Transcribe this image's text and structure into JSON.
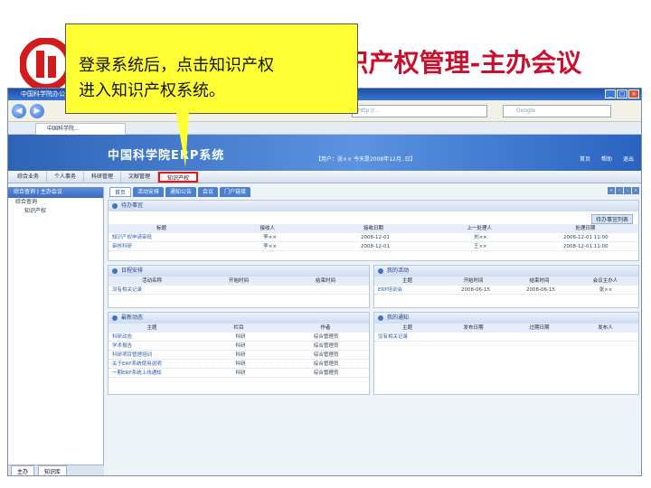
{
  "slide": {
    "title": "四-知识产权管理-主办会议",
    "callout_text": "登录系统后，点击知识产权\n进入知识产权系统。"
  },
  "browser": {
    "window_title": "中国科学院办公自",
    "address": "http://...",
    "search_placeholder": "Google",
    "tab_label": "中国科学院..."
  },
  "app": {
    "title": "中国科学院ERP系统",
    "user_info": "【用户：张××  今天是2008年12月..日】",
    "links": [
      "首页",
      "帮助",
      "退出"
    ],
    "modules": [
      "综合业务",
      "个人事务",
      "科研管理",
      "文献管理",
      "知识产权"
    ],
    "active_module": "知识产权"
  },
  "left_panel": {
    "header": "综合查询 | 主办会议",
    "tree": [
      "综合查询",
      "知识产权"
    ],
    "footer": [
      "主办",
      "知识库"
    ]
  },
  "main": {
    "subtabs": [
      "首页",
      "活动安排",
      "通知公告",
      "会议",
      "门户链接"
    ],
    "panels": {
      "todo": {
        "title": "待办事宜",
        "more": "待办事宜列表",
        "columns": [
          "标题",
          "接收人",
          "接收日期",
          "上一处理人",
          "处理日期"
        ],
        "rows": [
          [
            "知识产权申请审批",
            "李××",
            "2008-12-01",
            "刘××",
            "2008-12-01 11:00"
          ],
          [
            "审核科研",
            "李××",
            "2008-12-01",
            "王××",
            "2008-12-01 11:00"
          ]
        ]
      },
      "schedule": {
        "title": "日程安排",
        "columns": [
          "活动名称",
          "开始时间",
          "结束时间"
        ],
        "rows": [
          [
            "没有相关记录",
            "",
            ""
          ]
        ]
      },
      "activities": {
        "title": "我的活动",
        "columns": [
          "主题",
          "开始时间",
          "结束时间",
          "会议主办人"
        ],
        "rows": [
          [
            "ERP培训会",
            "2008-06-15",
            "2008-06-15",
            "张××"
          ]
        ]
      },
      "news": {
        "title": "最新动态",
        "columns": [
          "主题",
          "栏目",
          "作者"
        ],
        "rows": [
          [
            "科研动态",
            "科研",
            "综合管理员"
          ],
          [
            "学术报告",
            "科研",
            "综合管理员"
          ],
          [
            "科研项目管理培训",
            "科研",
            "综合管理员"
          ],
          [
            "关于ERP系统使用说明",
            "科研",
            "综合管理员"
          ],
          [
            "一期ERP系统上线通知",
            "科研",
            "综合管理员"
          ]
        ]
      },
      "notices": {
        "title": "我的通知",
        "columns": [
          "主题",
          "发布日期",
          "过期日期",
          "发布人"
        ],
        "rows": [
          [
            "没有相关记录",
            "",
            "",
            ""
          ]
        ]
      }
    }
  },
  "colors": {
    "title_red": "#c8102e",
    "callout_yellow": "#ffff33",
    "banner_blue": "#2e64b8",
    "highlight_red": "#e01818"
  }
}
